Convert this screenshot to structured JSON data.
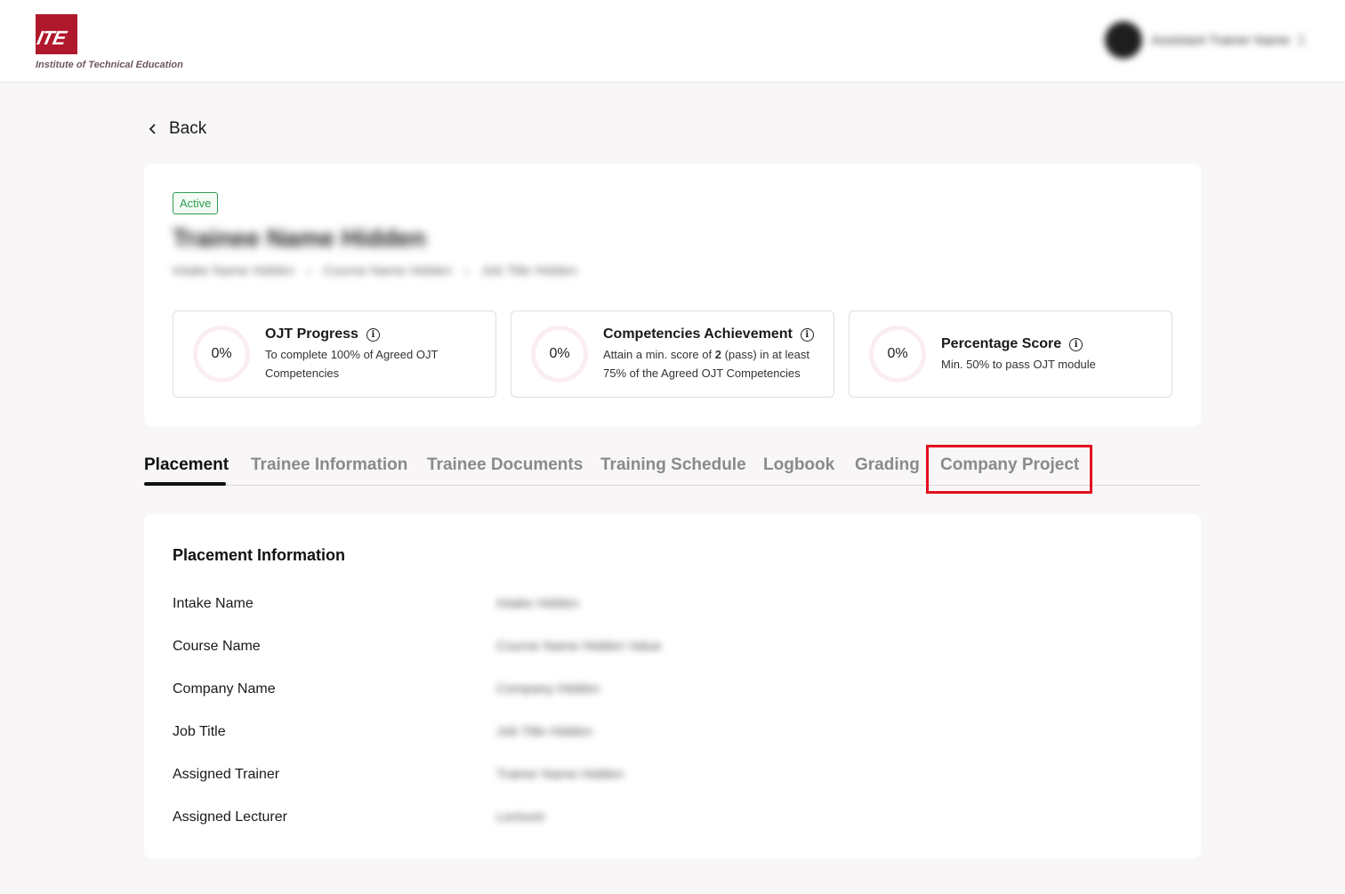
{
  "brand": {
    "logo_mark": "ITE",
    "logo_text": "Institute of Technical Education"
  },
  "user": {
    "name": "Assistant Trainer Name"
  },
  "nav": {
    "back_label": "Back"
  },
  "profile": {
    "status": "Active",
    "name": "Trainee Name Hidden",
    "intake": "Intake Name Hidden",
    "course": "Course Name Hidden",
    "job": "Job Title Hidden"
  },
  "stats": [
    {
      "percent": "0%",
      "title": "OJT Progress",
      "desc": "To complete 100% of Agreed OJT Competencies"
    },
    {
      "percent": "0%",
      "title": "Competencies Achievement",
      "desc_pre": "Attain a min. score of ",
      "desc_bold": "2",
      "desc_post": " (pass) in at least 75% of the Agreed OJT Competencies"
    },
    {
      "percent": "0%",
      "title": "Percentage Score",
      "desc": "Min. 50% to pass OJT module"
    }
  ],
  "tabs": [
    "Placement",
    "Trainee Information",
    "Trainee Documents",
    "Training Schedule",
    "Logbook",
    "Grading",
    "Company Project"
  ],
  "placement": {
    "heading": "Placement Information",
    "rows": [
      {
        "label": "Intake Name",
        "value": "Intake Hidden"
      },
      {
        "label": "Course Name",
        "value": "Course Name Hidden Value"
      },
      {
        "label": "Company Name",
        "value": "Company Hidden"
      },
      {
        "label": "Job Title",
        "value": "Job Title Hidden"
      },
      {
        "label": "Assigned Trainer",
        "value": "Trainer Name Hidden"
      },
      {
        "label": "Assigned Lecturer",
        "value": "Lecturer"
      }
    ]
  }
}
